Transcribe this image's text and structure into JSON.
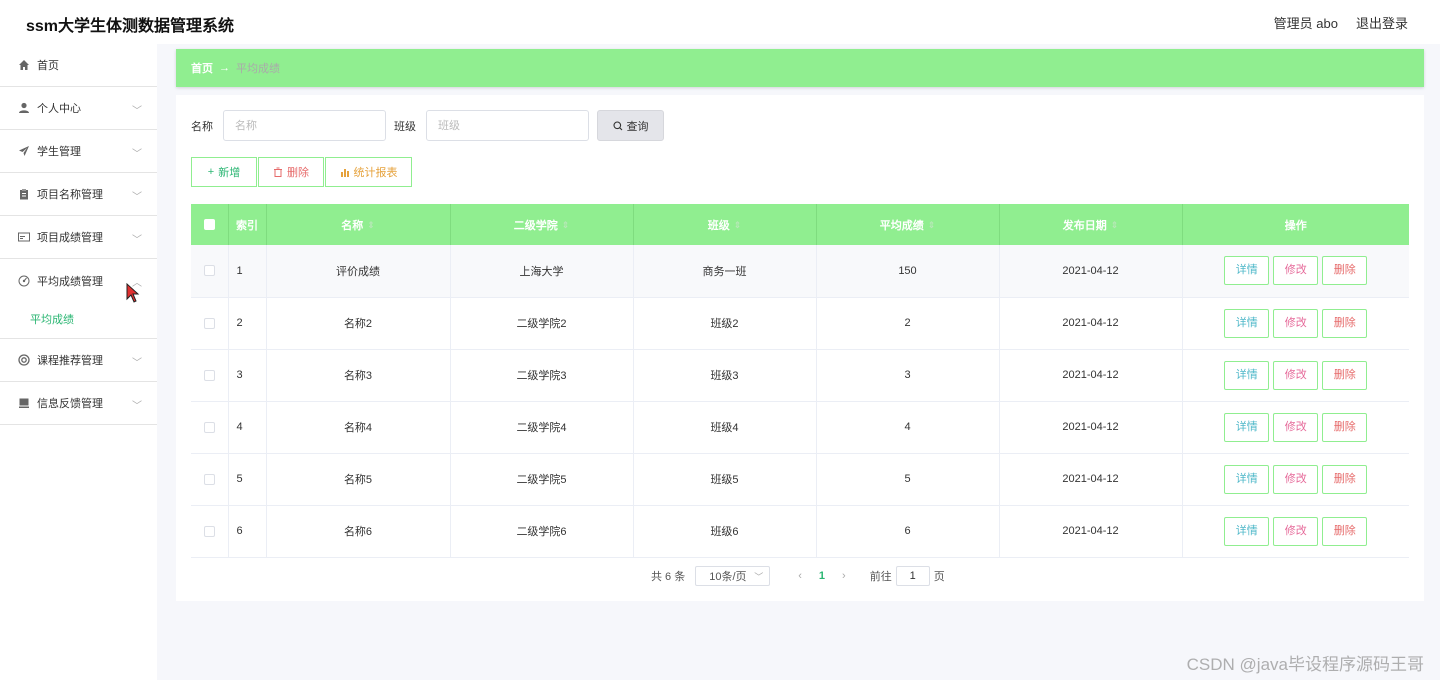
{
  "header": {
    "title": "ssm大学生体测数据管理系统",
    "user": "管理员 abo",
    "logout": "退出登录"
  },
  "sidebar": {
    "items": [
      {
        "label": "首页",
        "icon": "home-icon"
      },
      {
        "label": "个人中心",
        "icon": "user-icon"
      },
      {
        "label": "学生管理",
        "icon": "send-icon"
      },
      {
        "label": "项目名称管理",
        "icon": "clipboard-icon"
      },
      {
        "label": "项目成绩管理",
        "icon": "card-icon"
      },
      {
        "label": "平均成绩管理",
        "icon": "dial-icon"
      },
      {
        "label": "课程推荐管理",
        "icon": "life-ring-icon"
      },
      {
        "label": "信息反馈管理",
        "icon": "feedback-icon"
      }
    ],
    "submenu": {
      "label": "平均成绩"
    }
  },
  "breadcrumb": {
    "home": "首页",
    "current": "平均成绩"
  },
  "search": {
    "name_label": "名称",
    "name_placeholder": "名称",
    "class_label": "班级",
    "class_placeholder": "班级",
    "button": "查询"
  },
  "actions": {
    "add": "新增",
    "delete": "删除",
    "stats": "统计报表"
  },
  "table": {
    "columns": [
      "索引",
      "名称",
      "二级学院",
      "班级",
      "平均成绩",
      "发布日期",
      "操作"
    ],
    "rows": [
      {
        "index": "1",
        "name": "评价成绩",
        "college": "上海大学",
        "class": "商务一班",
        "avg": "150",
        "date": "2021-04-12"
      },
      {
        "index": "2",
        "name": "名称2",
        "college": "二级学院2",
        "class": "班级2",
        "avg": "2",
        "date": "2021-04-12"
      },
      {
        "index": "3",
        "name": "名称3",
        "college": "二级学院3",
        "class": "班级3",
        "avg": "3",
        "date": "2021-04-12"
      },
      {
        "index": "4",
        "name": "名称4",
        "college": "二级学院4",
        "class": "班级4",
        "avg": "4",
        "date": "2021-04-12"
      },
      {
        "index": "5",
        "name": "名称5",
        "college": "二级学院5",
        "class": "班级5",
        "avg": "5",
        "date": "2021-04-12"
      },
      {
        "index": "6",
        "name": "名称6",
        "college": "二级学院6",
        "class": "班级6",
        "avg": "6",
        "date": "2021-04-12"
      }
    ],
    "row_actions": {
      "detail": "详情",
      "edit": "修改",
      "delete": "删除"
    }
  },
  "pagination": {
    "total": "共 6 条",
    "page_size": "10条/页",
    "current_page": "1",
    "goto_label": "前往",
    "goto_value": "1",
    "page_suffix": "页"
  },
  "watermark": "CSDN @java毕设程序源码王哥",
  "colors": {
    "accent_green": "#90ee90",
    "active_text": "#2bb673"
  }
}
